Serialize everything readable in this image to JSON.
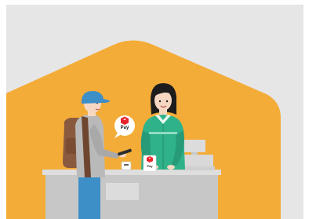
{
  "illustration": {
    "pay_bubble_label": "Pay",
    "pay_card_label": "Pay"
  },
  "colors": {
    "backdrop": "#e6e6e6",
    "house_accent": "#f4ac38",
    "counter": "#c8c8c8",
    "cashier_uniform": "#2fb28a",
    "customer_cap": "#3d8fc8",
    "backpack": "#8a5a3e",
    "pay_brand": "#e8232a"
  }
}
